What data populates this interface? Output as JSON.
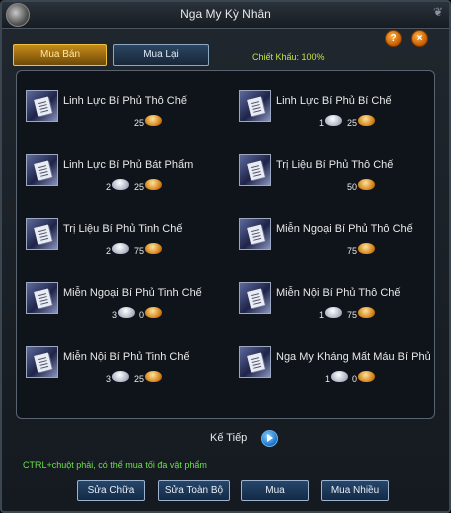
{
  "window": {
    "title": "Nga My Kỳ Nhân"
  },
  "tabs": {
    "sell": "Mua Bán",
    "buy": "Mua Lại"
  },
  "discount": "Chiết Khấu: 100%",
  "help_label": "?",
  "close_label": "×",
  "items": [
    {
      "name": "Linh Lực Bí Phủ Thô Chế",
      "silver": "",
      "gold": "25"
    },
    {
      "name": "Linh Lực Bí Phủ Bí Chế",
      "silver": "1",
      "gold": "25"
    },
    {
      "name": "Linh Lực Bí Phủ Bát Phẩm",
      "silver": "2",
      "gold": "25"
    },
    {
      "name": "Trị Liệu Bí Phủ Thô Chế",
      "silver": "",
      "gold": "50"
    },
    {
      "name": "Trị Liệu Bí Phủ Tinh Chế",
      "silver": "2",
      "gold": "75"
    },
    {
      "name": "Miễn Ngoại Bí Phủ Thô Chế",
      "silver": "",
      "gold": "75"
    },
    {
      "name": "Miễn Ngoại Bí Phủ Tinh Chế",
      "silver": "3",
      "gold": "0"
    },
    {
      "name": "Miễn Nội Bí Phủ Thô Chế",
      "silver": "1",
      "gold": "75"
    },
    {
      "name": "Miễn Nội Bí Phủ Tinh Chế",
      "silver": "3",
      "gold": "25"
    },
    {
      "name": "Nga My Kháng Mất Máu Bí Phủ",
      "silver": "1",
      "gold": "0"
    }
  ],
  "next_label": "Kế Tiếp",
  "hint": "CTRL+chuột phải, có thể mua tối đa vật phẩm",
  "buttons": {
    "repair": "Sửa Chữa",
    "repair_all": "Sửa Toàn Bộ",
    "buy": "Mua",
    "buy_many": "Mua Nhiều"
  }
}
